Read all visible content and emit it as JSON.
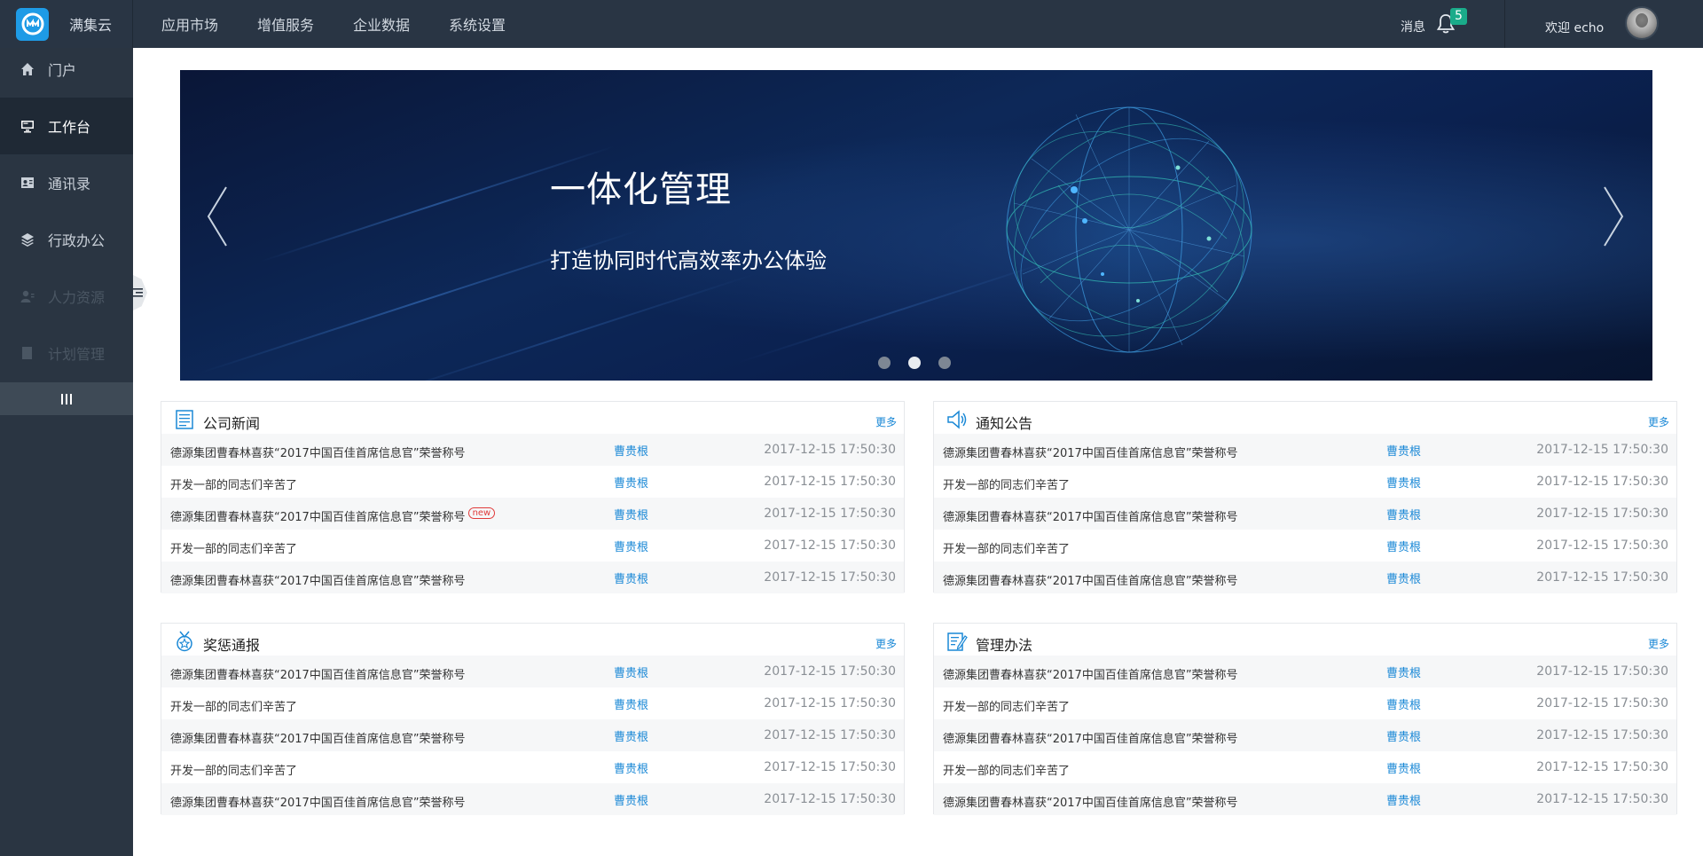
{
  "header": {
    "brand": "满集云",
    "nav": [
      "应用市场",
      "增值服务",
      "企业数据",
      "系统设置"
    ],
    "message_label": "消息",
    "message_count": "5",
    "welcome": "欢迎 echo"
  },
  "sidebar": {
    "items": [
      {
        "label": "门户",
        "icon": "home-icon"
      },
      {
        "label": "工作台",
        "icon": "monitor-icon"
      },
      {
        "label": "通讯录",
        "icon": "contacts-icon"
      },
      {
        "label": "行政办公",
        "icon": "layers-icon"
      },
      {
        "label": "人力资源",
        "icon": "user-icon"
      },
      {
        "label": "计划管理",
        "icon": "document-icon"
      }
    ],
    "active_index": 1
  },
  "banner": {
    "title": "一体化管理",
    "subtitle": "打造协同时代高效率办公体验",
    "slide_count": 3,
    "active_slide": 2
  },
  "panels": [
    {
      "title": "公司新闻",
      "more": "更多",
      "icon": "news-icon",
      "rows": [
        {
          "title": "德源集团曹春林喜获“2017中国百佳首席信息官”荣誉称号",
          "author": "曹贵根",
          "time": "2017-12-15 17:50:30"
        },
        {
          "title": "开发一部的同志们辛苦了",
          "author": "曹贵根",
          "time": "2017-12-15 17:50:30"
        },
        {
          "title": "德源集团曹春林喜获“2017中国百佳首席信息官”荣誉称号",
          "author": "曹贵根",
          "time": "2017-12-15 17:50:30",
          "tag": "new"
        },
        {
          "title": "开发一部的同志们辛苦了",
          "author": "曹贵根",
          "time": "2017-12-15 17:50:30"
        },
        {
          "title": "德源集团曹春林喜获“2017中国百佳首席信息官”荣誉称号",
          "author": "曹贵根",
          "time": "2017-12-15 17:50:30"
        }
      ]
    },
    {
      "title": "通知公告",
      "more": "更多",
      "icon": "megaphone-icon",
      "rows": [
        {
          "title": "德源集团曹春林喜获“2017中国百佳首席信息官”荣誉称号",
          "author": "曹贵根",
          "time": "2017-12-15 17:50:30"
        },
        {
          "title": "开发一部的同志们辛苦了",
          "author": "曹贵根",
          "time": "2017-12-15 17:50:30"
        },
        {
          "title": "德源集团曹春林喜获“2017中国百佳首席信息官”荣誉称号",
          "author": "曹贵根",
          "time": "2017-12-15 17:50:30"
        },
        {
          "title": "开发一部的同志们辛苦了",
          "author": "曹贵根",
          "time": "2017-12-15 17:50:30"
        },
        {
          "title": "德源集团曹春林喜获“2017中国百佳首席信息官”荣誉称号",
          "author": "曹贵根",
          "time": "2017-12-15 17:50:30"
        }
      ]
    },
    {
      "title": "奖惩通报",
      "more": "更多",
      "icon": "medal-icon",
      "rows": [
        {
          "title": "德源集团曹春林喜获“2017中国百佳首席信息官”荣誉称号",
          "author": "曹贵根",
          "time": "2017-12-15 17:50:30"
        },
        {
          "title": "开发一部的同志们辛苦了",
          "author": "曹贵根",
          "time": "2017-12-15 17:50:30"
        },
        {
          "title": "德源集团曹春林喜获“2017中国百佳首席信息官”荣誉称号",
          "author": "曹贵根",
          "time": "2017-12-15 17:50:30"
        },
        {
          "title": "开发一部的同志们辛苦了",
          "author": "曹贵根",
          "time": "2017-12-15 17:50:30"
        },
        {
          "title": "德源集团曹春林喜获“2017中国百佳首席信息官”荣誉称号",
          "author": "曹贵根",
          "time": "2017-12-15 17:50:30"
        }
      ]
    },
    {
      "title": "管理办法",
      "more": "更多",
      "icon": "edit-doc-icon",
      "rows": [
        {
          "title": "德源集团曹春林喜获“2017中国百佳首席信息官”荣誉称号",
          "author": "曹贵根",
          "time": "2017-12-15 17:50:30"
        },
        {
          "title": "开发一部的同志们辛苦了",
          "author": "曹贵根",
          "time": "2017-12-15 17:50:30"
        },
        {
          "title": "德源集团曹春林喜获“2017中国百佳首席信息官”荣誉称号",
          "author": "曹贵根",
          "time": "2017-12-15 17:50:30"
        },
        {
          "title": "开发一部的同志们辛苦了",
          "author": "曹贵根",
          "time": "2017-12-15 17:50:30"
        },
        {
          "title": "德源集团曹春林喜获“2017中国百佳首席信息官”荣誉称号",
          "author": "曹贵根",
          "time": "2017-12-15 17:50:30"
        }
      ]
    }
  ],
  "colors": {
    "topbar": "#293544",
    "sidebar": "#2a3542",
    "accent": "#1a88d6",
    "badge": "#1aab8a"
  }
}
